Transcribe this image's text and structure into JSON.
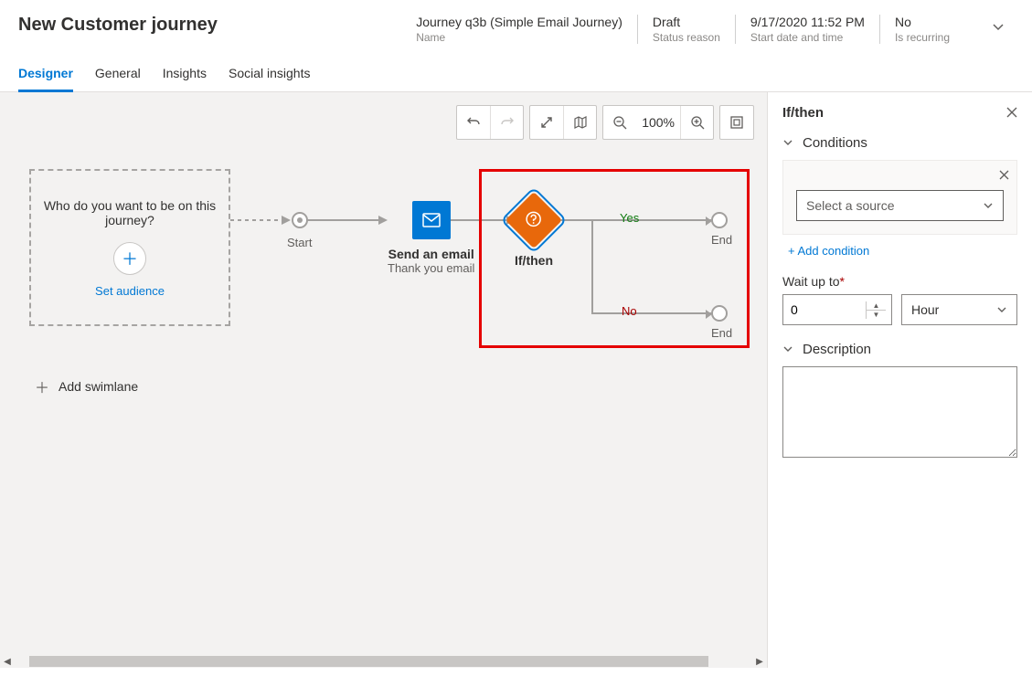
{
  "header": {
    "title": "New Customer journey",
    "fields": [
      {
        "value": "Journey q3b (Simple Email Journey)",
        "label": "Name"
      },
      {
        "value": "Draft",
        "label": "Status reason"
      },
      {
        "value": "9/17/2020 11:52 PM",
        "label": "Start date and time"
      },
      {
        "value": "No",
        "label": "Is recurring"
      }
    ]
  },
  "tabs": [
    "Designer",
    "General",
    "Insights",
    "Social insights"
  ],
  "toolbar": {
    "zoom": "100%"
  },
  "canvas": {
    "audience_question": "Who do you want to be on this journey?",
    "set_audience": "Set audience",
    "start_label": "Start",
    "email_title": "Send an email",
    "email_sub": "Thank you email",
    "ifthen_label": "If/then",
    "yes_label": "Yes",
    "no_label": "No",
    "end_label": "End",
    "add_swimlane": "Add swimlane"
  },
  "panel": {
    "title": "If/then",
    "conditions_label": "Conditions",
    "select_source_placeholder": "Select a source",
    "add_condition": "+ Add condition",
    "wait_label": "Wait up to",
    "wait_value": "0",
    "wait_unit": "Hour",
    "description_label": "Description",
    "description_value": ""
  }
}
